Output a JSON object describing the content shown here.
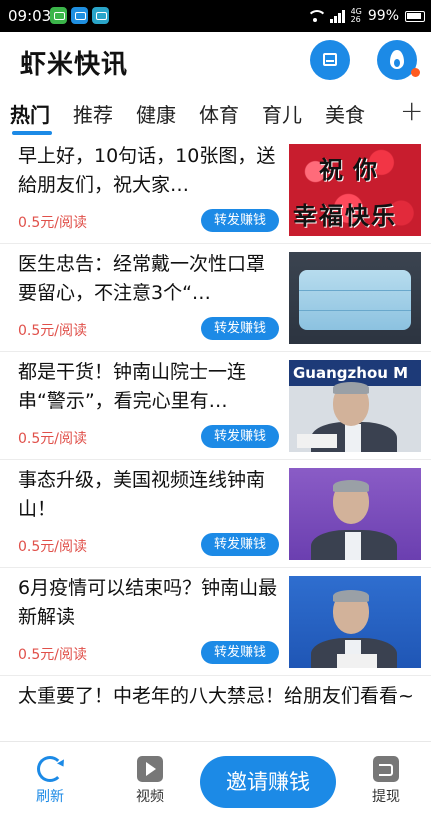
{
  "status_bar": {
    "time": "09:03",
    "network": "4G",
    "network_sub": "26",
    "battery": "99%"
  },
  "header": {
    "title": "虾米快讯",
    "accent_color": "#1c8ae6"
  },
  "tabs": [
    {
      "label": "热门",
      "active": true
    },
    {
      "label": "推荐"
    },
    {
      "label": "健康"
    },
    {
      "label": "体育"
    },
    {
      "label": "育儿"
    },
    {
      "label": "美食"
    }
  ],
  "tab_add": "+",
  "feed": {
    "items": [
      {
        "title": "早上好，10句话，10张图，送給朋友们，祝大家…",
        "price": "0.5元/阅读",
        "share_label": "转发赚钱",
        "image": "roses",
        "image_text_1": "祝你",
        "image_text_2": "幸福快乐"
      },
      {
        "title": "医生忠告：经常戴一次性口罩要留心，不注意3个“…",
        "price": "0.5元/阅读",
        "share_label": "转发赚钱",
        "image": "mask"
      },
      {
        "title": "都是干货！钟南山院士一连串“警示”，看完心里有…",
        "price": "0.5元/阅读",
        "share_label": "转发赚钱",
        "image": "person",
        "image_banner": "Guangzhou M"
      },
      {
        "title": "事态升级，美国视频连线钟南山！",
        "price": "0.5元/阅读",
        "share_label": "转发赚钱",
        "image": "person-purple"
      },
      {
        "title": "6月疫情可以结束吗？钟南山最新解读",
        "price": "0.5元/阅读",
        "share_label": "转发赚钱",
        "image": "person-blue"
      },
      {
        "title": "太重要了！中老年的八大禁忌！给朋友们看看~"
      }
    ]
  },
  "bottom_nav": {
    "refresh": "刷新",
    "video": "视频",
    "invite": "邀请赚钱",
    "withdraw": "提现"
  }
}
